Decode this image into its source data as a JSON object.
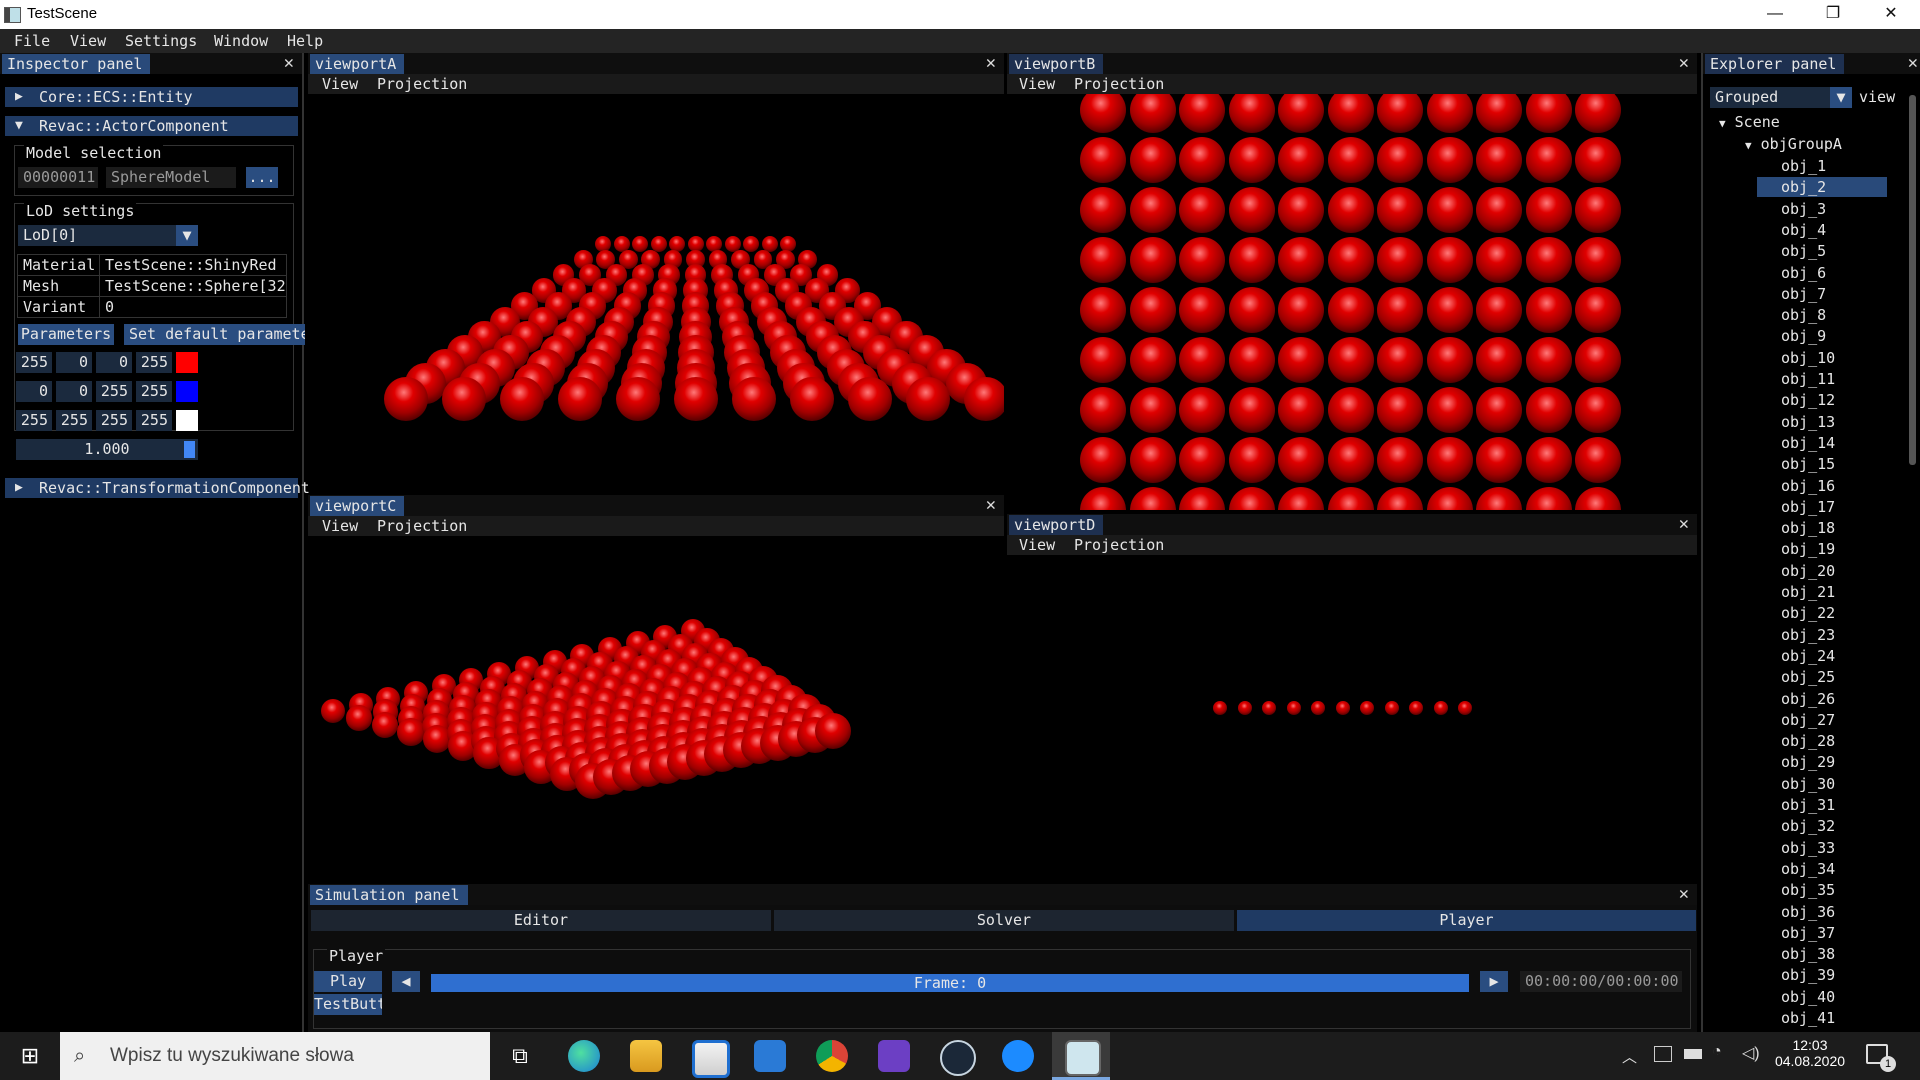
{
  "window": {
    "title": "TestScene",
    "minimize_glyph": "—",
    "restore_glyph": "❐",
    "close_glyph": "✕"
  },
  "menu": [
    "File",
    "View",
    "Settings",
    "Window",
    "Help"
  ],
  "inspector": {
    "tab": "Inspector panel",
    "entity_header": "Core::ECS::Entity",
    "actor_header": "Revac::ActorComponent",
    "model_selection_label": "Model selection",
    "model_id": "00000011",
    "model_name": "SphereModel",
    "browse_label": "...",
    "lod_settings_label": "LoD settings",
    "lod_select": "LoD[0]",
    "table": [
      {
        "key": "Material",
        "value": "TestScene::ShinyRed"
      },
      {
        "key": "Mesh",
        "value": "TestScene::Sphere[32|"
      },
      {
        "key": "Variant",
        "value": "0"
      }
    ],
    "parameters_button": "Parameters",
    "set_default_button": "Set default paramete",
    "colors": [
      {
        "values": [
          "255",
          "0",
          "0",
          "255"
        ],
        "swatch": "#ff0000"
      },
      {
        "values": [
          "0",
          "0",
          "255",
          "255"
        ],
        "swatch": "#0000ff"
      },
      {
        "values": [
          "255",
          "255",
          "255",
          "255"
        ],
        "swatch": "#ffffff"
      }
    ],
    "slider_value": "1.000",
    "transform_header": "Revac::TransformationComponent"
  },
  "viewports": {
    "A": {
      "tab": "viewportA",
      "menu_view": "View",
      "menu_projection": "Projection"
    },
    "B": {
      "tab": "viewportB",
      "menu_view": "View",
      "menu_projection": "Projection"
    },
    "C": {
      "tab": "viewportC",
      "menu_view": "View",
      "menu_projection": "Projection"
    },
    "D": {
      "tab": "viewportD",
      "menu_view": "View",
      "menu_projection": "Projection"
    }
  },
  "simulation": {
    "tab": "Simulation panel",
    "tabs": [
      "Editor",
      "Solver",
      "Player"
    ],
    "active_tab": "Player",
    "player_group_label": "Player",
    "play_button": "Play",
    "test_button": "TestButt",
    "frame_label": "Frame: 0",
    "time_label": "00:00:00/00:00:00"
  },
  "explorer": {
    "tab": "Explorer panel",
    "grouping": "Grouped",
    "view_label": "view",
    "scene_node": "Scene",
    "group_node": "objGroupA",
    "selected": "obj_2",
    "objects": [
      "obj_1",
      "obj_2",
      "obj_3",
      "obj_4",
      "obj_5",
      "obj_6",
      "obj_7",
      "obj_8",
      "obj_9",
      "obj_10",
      "obj_11",
      "obj_12",
      "obj_13",
      "obj_14",
      "obj_15",
      "obj_16",
      "obj_17",
      "obj_18",
      "obj_19",
      "obj_20",
      "obj_21",
      "obj_22",
      "obj_23",
      "obj_24",
      "obj_25",
      "obj_26",
      "obj_27",
      "obj_28",
      "obj_29",
      "obj_30",
      "obj_31",
      "obj_32",
      "obj_33",
      "obj_34",
      "obj_35",
      "obj_36",
      "obj_37",
      "obj_38",
      "obj_39",
      "obj_40",
      "obj_41"
    ]
  },
  "taskbar": {
    "search_placeholder": "Wpisz tu wyszukiwane słowa",
    "time": "12:03",
    "date": "04.08.2020",
    "notification_count": "1",
    "apps": [
      "task-view-icon",
      "edge-icon",
      "file-explorer-icon",
      "store-icon",
      "mail-icon",
      "chrome-icon",
      "visual-studio-icon",
      "steam-icon",
      "messenger-icon",
      "testscene-app-icon"
    ]
  },
  "colors": {
    "tab_active": "#294a7a",
    "header": "#1f3a63",
    "sphere": "#d00000",
    "progress": "#2f6fd0"
  }
}
